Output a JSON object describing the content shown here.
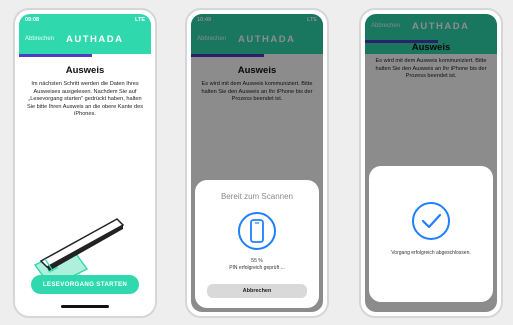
{
  "colors": {
    "brand": "#2fd8ad",
    "progress": "#4b3fc2",
    "nfc_blue": "#1f80ff"
  },
  "screens": [
    {
      "status_time": "09:08",
      "status_right": "LTE",
      "header_cancel": "Abbrechen",
      "brand": "AUTHADA",
      "title": "Ausweis",
      "text": "Im nächsten Schritt werden die Daten Ihres Ausweises ausgelesen. Nachdem Sie auf „Lesevorgang starten“ gedrückt haben, halten Sie bitte Ihren Ausweis an die obere Kante des iPhones.",
      "button": "LESEVORGANG STARTEN",
      "illustration_icon": "phone-on-id-card-icon",
      "progress": 0.55
    },
    {
      "status_time": "10:49",
      "status_right": "LTE",
      "header_cancel": "Abbrechen",
      "brand": "AUTHADA",
      "title": "Ausweis",
      "text": "Es wird mit dem Ausweis kommuniziert. Bitte halten Sie den Ausweis an Ihr iPhone bis der Prozess beendet ist.",
      "sheet_title": "Bereit zum Scannen",
      "sheet_icon": "phone-scan-icon",
      "percent": "55 %",
      "status": "PIN erfolgreich geprüft ...",
      "sheet_button": "Abbrechen",
      "progress": 0.55
    },
    {
      "header_cancel": "Abbrechen",
      "brand": "AUTHADA",
      "title": "Ausweis",
      "text": "Es wird mit dem Ausweis kommuniziert. Bitte halten Sie den Ausweis an Ihr iPhone bis der Prozess beendet ist.",
      "sheet_icon": "checkmark-icon",
      "done_text": "Vorgang erfolgreich abgeschlossen.",
      "progress": 0.55
    }
  ]
}
